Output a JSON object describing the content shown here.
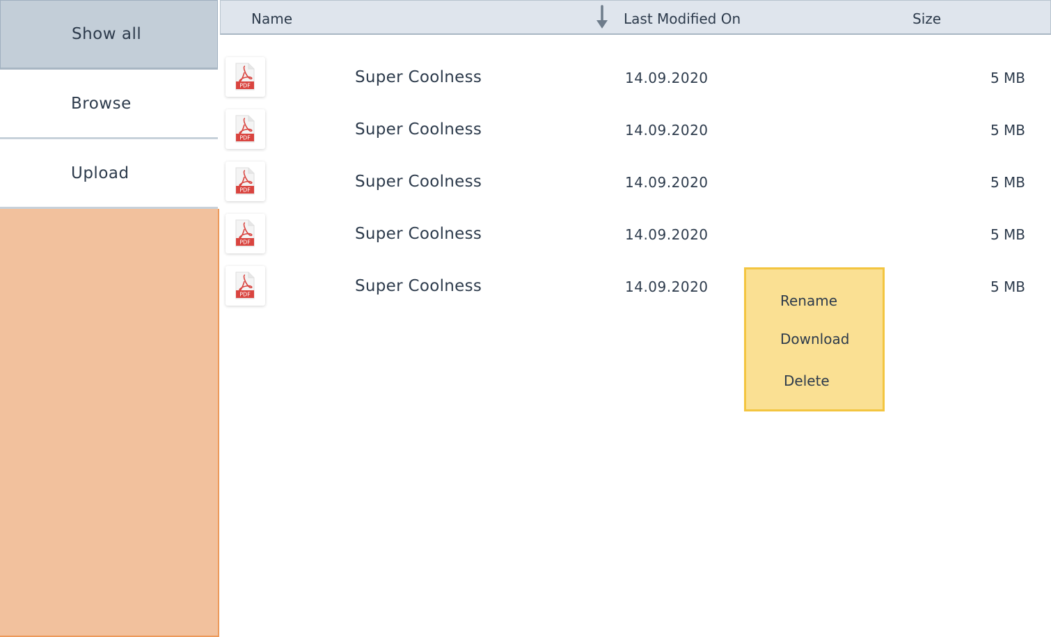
{
  "sidebar": {
    "items": [
      {
        "label": "Show all",
        "active": true
      },
      {
        "label": "Browse",
        "active": false
      },
      {
        "label": "Upload",
        "active": false
      }
    ]
  },
  "table": {
    "columns": {
      "name": "Name",
      "modified": "Last Modified On",
      "size": "Size"
    },
    "sort": {
      "column": "modified",
      "direction": "descending",
      "icon": "arrow-down-icon"
    },
    "rows": [
      {
        "icon": "pdf-icon",
        "name": "Super Coolness",
        "modified": "14.09.2020",
        "size": "5 MB"
      },
      {
        "icon": "pdf-icon",
        "name": "Super Coolness",
        "modified": "14.09.2020",
        "size": "5 MB"
      },
      {
        "icon": "pdf-icon",
        "name": "Super Coolness",
        "modified": "14.09.2020",
        "size": "5 MB"
      },
      {
        "icon": "pdf-icon",
        "name": "Super Coolness",
        "modified": "14.09.2020",
        "size": "5 MB"
      },
      {
        "icon": "pdf-icon",
        "name": "Super Coolness",
        "modified": "14.09.2020",
        "size": "5 MB"
      }
    ]
  },
  "context_menu": {
    "items": [
      "Rename",
      "Download",
      "Delete"
    ]
  },
  "colors": {
    "sidebar_active": "#c3ced8",
    "sidebar_fill": "#f2c19d",
    "sidebar_fill_border": "#ec9a5b",
    "header_bg": "#dfe5ed",
    "context_menu_bg": "#fae093",
    "context_menu_border": "#f3c540",
    "pdf_red": "#d9443f",
    "text": "#2c3a4b"
  }
}
